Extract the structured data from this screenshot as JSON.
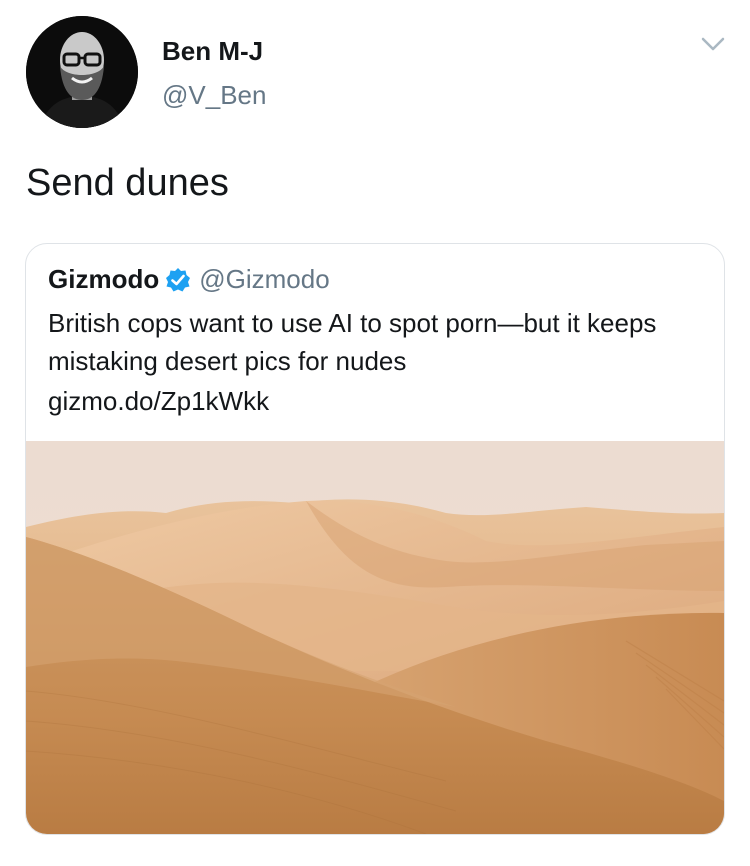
{
  "tweet": {
    "author_name": "Ben M-J",
    "author_handle": "@V_Ben",
    "text": "Send dunes",
    "menu_icon": "chevron-down-icon",
    "avatar_icon": "user-avatar"
  },
  "quoted_tweet": {
    "author_name": "Gizmodo",
    "author_handle": "@Gizmodo",
    "verified_icon": "verified-badge-icon",
    "text": "British cops want to use AI to spot porn—but it keeps mistaking desert pics for nudes",
    "link": "gizmo.do/Zp1kWkk",
    "image": "desert-dunes-photo"
  },
  "colors": {
    "text_primary": "#14171a",
    "text_secondary": "#657786",
    "verified_blue": "#1da1f2",
    "card_border": "#dfe3e7",
    "sand_light": "#e6b98d",
    "sand_dark": "#bf8149"
  }
}
